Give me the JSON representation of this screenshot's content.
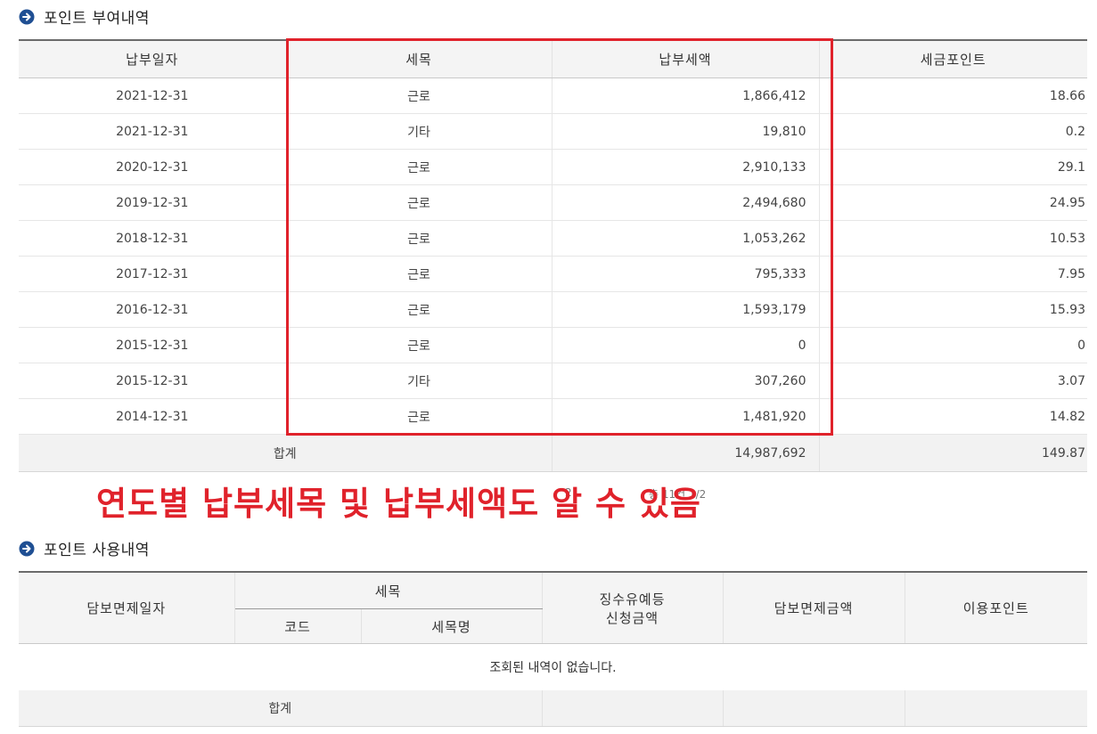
{
  "section1": {
    "title": "포인트 부여내역",
    "columns": [
      "납부일자",
      "세목",
      "납부세액",
      "세금포인트"
    ],
    "rows": [
      {
        "date": "2021-12-31",
        "tax_item": "근로",
        "amount": "1,866,412",
        "points": "18.66"
      },
      {
        "date": "2021-12-31",
        "tax_item": "기타",
        "amount": "19,810",
        "points": "0.2"
      },
      {
        "date": "2020-12-31",
        "tax_item": "근로",
        "amount": "2,910,133",
        "points": "29.1"
      },
      {
        "date": "2019-12-31",
        "tax_item": "근로",
        "amount": "2,494,680",
        "points": "24.95"
      },
      {
        "date": "2018-12-31",
        "tax_item": "근로",
        "amount": "1,053,262",
        "points": "10.53"
      },
      {
        "date": "2017-12-31",
        "tax_item": "근로",
        "amount": "795,333",
        "points": "7.95"
      },
      {
        "date": "2016-12-31",
        "tax_item": "근로",
        "amount": "1,593,179",
        "points": "15.93"
      },
      {
        "date": "2015-12-31",
        "tax_item": "근로",
        "amount": "0",
        "points": "0"
      },
      {
        "date": "2015-12-31",
        "tax_item": "기타",
        "amount": "307,260",
        "points": "3.07"
      },
      {
        "date": "2014-12-31",
        "tax_item": "근로",
        "amount": "1,481,920",
        "points": "14.82"
      }
    ],
    "total": {
      "label": "합계",
      "amount": "14,987,692",
      "points": "149.87"
    }
  },
  "pagination": {
    "page": "2",
    "total": "총 11건 1/2"
  },
  "annotation": {
    "text": "연도별 납부세목 및 납부세액도 알 수 있음",
    "color": "#e0222b"
  },
  "section2": {
    "title": "포인트 사용내역",
    "columns": {
      "date": "담보면제일자",
      "tax_item": "세목",
      "code": "코드",
      "tax_name": "세목명",
      "request_amount_line1": "징수유예등",
      "request_amount_line2": "신청금액",
      "exempt_amount": "담보면제금액",
      "used_points": "이용포인트"
    },
    "empty_message": "조회된 내역이 없습니다.",
    "total_label": "합계"
  },
  "icons": {
    "section_bullet": "arrow-right-circle-icon"
  },
  "colors": {
    "bullet": "#1f4f93",
    "annotation": "#e0222b"
  }
}
